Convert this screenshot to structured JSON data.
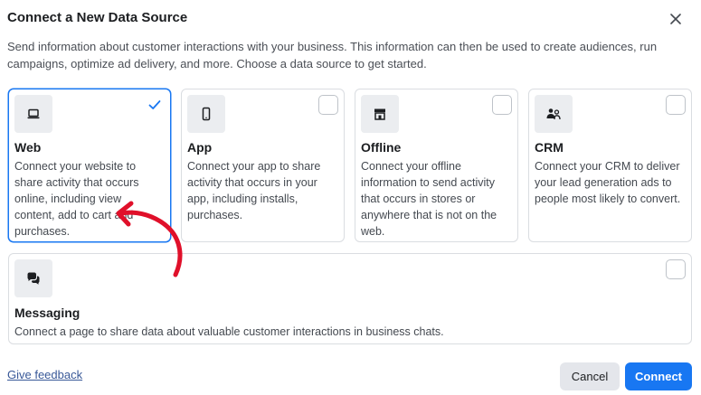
{
  "dialog": {
    "title": "Connect a New Data Source",
    "description": "Send information about customer interactions with your business. This information can then be used to create audiences, run campaigns, optimize ad delivery, and more. Choose a data source to get started."
  },
  "sources": [
    {
      "title": "Web",
      "description": "Connect your website to share activity that occurs online, including view content, add to cart and purchases.",
      "icon": "laptop-icon",
      "selected": true
    },
    {
      "title": "App",
      "description": "Connect your app to share activity that occurs in your app, including installs, purchases.",
      "icon": "mobile-phone-icon",
      "selected": false
    },
    {
      "title": "Offline",
      "description": "Connect your offline information to send activity that occurs in stores or anywhere that is not on the web.",
      "icon": "storefront-icon",
      "selected": false
    },
    {
      "title": "CRM",
      "description": "Connect your CRM to deliver your lead generation ads to people most likely to convert.",
      "icon": "people-icon",
      "selected": false
    },
    {
      "title": "Messaging",
      "description": "Connect a page to share data about valuable customer interactions in business chats.",
      "icon": "chat-bubbles-icon",
      "selected": false
    }
  ],
  "footer": {
    "feedback_link": "Give feedback",
    "cancel_label": "Cancel",
    "connect_label": "Connect"
  },
  "colors": {
    "accent": "#1877f2",
    "annotation_arrow": "#e0102a"
  }
}
